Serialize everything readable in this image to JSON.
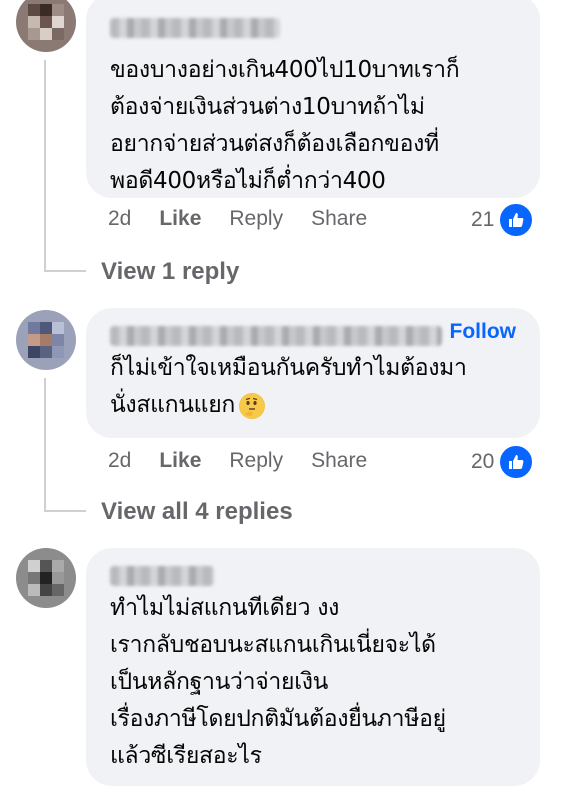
{
  "comments": [
    {
      "author": "",
      "text": "ของบางอย่างเกิน400ไป10บาทเราก็\nต้องจ่ายเงินส่วนต่าง10บาทถ้าไม่\nอยากจ่ายส่วนต่สงก็ต้องเลือกของที่\nพอดี400หรือไม่ก็ต่ำกว่า400",
      "time": "2d",
      "like": "Like",
      "reply": "Reply",
      "share": "Share",
      "reaction_count": "21",
      "view_replies": "View 1 reply"
    },
    {
      "author": "",
      "follow": "Follow",
      "text": "ก็ไม่เข้าใจเหมือนกันครับทำไมต้องมา\nนั่งสแกนแยก",
      "emoji": "thinking-face",
      "time": "2d",
      "like": "Like",
      "reply": "Reply",
      "share": "Share",
      "reaction_count": "20",
      "view_replies": "View all 4 replies"
    },
    {
      "author": "",
      "text": "ทำไมไม่สแกนทีเดียว งง\nเรากลับชอบนะสแกนเกินเนี่ยจะได้\nเป็นหลักฐานว่าจ่ายเงิน\nเรื่องภาษีโดยปกติมันต้องยื่นภาษีอยู่\nแล้วซีเรียสอะไร"
    }
  ],
  "colors": {
    "bubble": "#f0f2f5",
    "like_blue": "#0866ff",
    "meta": "#65676b"
  }
}
